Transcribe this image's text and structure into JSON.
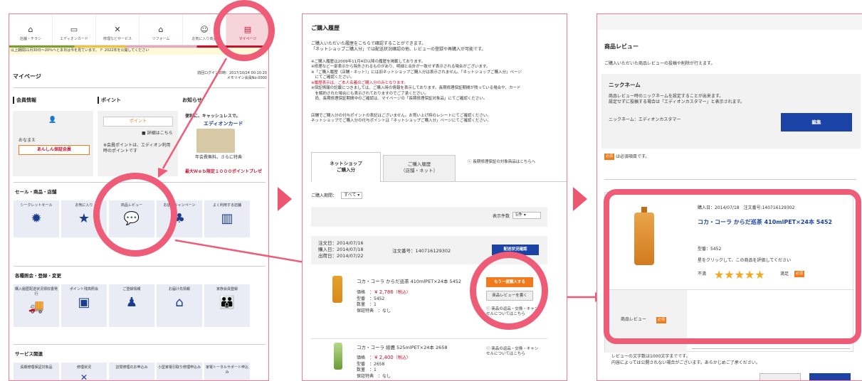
{
  "panel1": {
    "nav": [
      {
        "label": "店舗・チラシ",
        "icon": "shop-icon"
      },
      {
        "label": "エディオンカード",
        "icon": "card-icon"
      },
      {
        "label": "修理などサービス",
        "icon": "tools-icon"
      },
      {
        "label": "リフォーム",
        "icon": "house-icon"
      },
      {
        "label": "お気に入り商品",
        "icon": "heart-icon"
      },
      {
        "label": "マイページ",
        "icon": "mypage-icon"
      }
    ],
    "notice": "以上期間11月30日～20％ヘと本日は今を見ています。 Ｆ 2022年を公開してください",
    "title": "マイページ",
    "login_info": "前回ログイン日時：2017/10/24 00:10:20",
    "member_no": "メモリイン会員No:0000",
    "col1": "会員情報",
    "col2": "ポイント",
    "col3": "お知らせ",
    "member_name": "おなまえ",
    "member_rank": "あんしん保証会員",
    "point_label": "ポイント",
    "point_detail": "■ 詳細はこちら",
    "point_text": "※会員ポイントは、エディオン利用時のポイントです",
    "news_title": "便利に、キャッシュレスで。",
    "card_title": "エディオンカード",
    "card_text": "年会費無料。さらに特典",
    "campaign": "最大Ｗｅｂ限定１０００ポイントプレゼ",
    "sec1": "セール・商品・店舗",
    "sec1_tiles": [
      "シークレットセール",
      "お気に入り",
      "商品レビュー",
      "お店のキャンペーン",
      "よく利用する店舗"
    ],
    "sec2": "各種照会・登録・変更",
    "sec2_tiles": [
      "購入履歴配送状況領収書発行",
      "ポイント残高照会",
      "ご登録情報",
      "お届け先情報",
      "家族会員登録"
    ],
    "sec3": "サービス関連",
    "sec3_tiles": [
      "長期修理保証対象品",
      "修理状況",
      "訪問修理のお申込み",
      "小型家電引取り修理申込み",
      "家電トータルサポート申込み"
    ]
  },
  "panel2": {
    "title": "ご購入履歴",
    "intro1": "ご購入いただいた履歴をこちらで確認することができます。",
    "intro2": "「ネットショップご購入分」では配送状況確認の他、レビューの登録や再購入が可能です。",
    "notes": [
      "※ご購入履歴は2009年11月4日以降の履歴を掲載しております。",
      "※修理など一部表示から除外されるものがあり、明細と合計が一致せず表示される場合がございます。",
      "※「ご購入履歴（店舗・ネット）」には旧ネットショップご購入分は表示されません。「ネットショップご購入分」ページ",
      "　にてご確認ください。",
      "※履歴表示は、ご本人名義のご購入分のみとなります。",
      "※保証情報の記載につきましては、ご購入時の情報を表示しております。長期修理保証期間が残っている場合や、カード",
      "　を解約された場合にも表示されておりますのでご了承ください。",
      "　尚、長期修理保証期間中のご確認は、マイページの「長期修理保証対象品」にてご確認ください。"
    ],
    "notes2": [
      "店舗でご購入分の付与ポイントの表記はございません。お買い上げ時のレシートにてご確認ください。",
      "ネットショップでご購入分の付与ポイントは「ネットショップご購入分」ページにてご確認ください。"
    ],
    "tab_active": [
      "ネットショップ",
      "ご購入分"
    ],
    "tab_inactive": [
      "ご購入履歴",
      "（店舗・ネット）"
    ],
    "long_warranty": "ⓘ 長期修理保証の対象商品はこちらへ",
    "period_label": "ご購入期間：",
    "period_value": "すべて",
    "per_page_label": "表示件数",
    "per_page_value": "5件",
    "order": {
      "ordered": "注文日：2014/07/16",
      "bought": "購入日：2014/07/18",
      "shipped": "出荷日：2014/07/22",
      "order_no": "注文番号：140716129302",
      "track_btn": "配送状況確認"
    },
    "items": [
      {
        "name": "コカ・コーラ からだ巡茶 410mlPET×24本 5452",
        "price_label": "価格",
        "price": "：¥ 2,786",
        "tax": "（税込）",
        "code_label": "型番",
        "code": "：5452",
        "qty_label": "数量",
        "qty": "：1",
        "warranty_label": "保証特典",
        "warranty": "：なし"
      },
      {
        "name": "コカ・コーラ 綾鷹 525mlPET×24本 2658",
        "price_label": "価格",
        "price": "：¥ 2,400",
        "tax": "（税込）",
        "code_label": "型番",
        "code": "：2658",
        "qty_label": "数量",
        "qty": "：1",
        "warranty_label": "保証特典",
        "warranty": "：なし"
      }
    ],
    "rebuy_btn": "もう一度購入する",
    "review_btn": "商品レビューを書く",
    "return_text": "ⓘ 商品の返品・交換・キャンセルについてはこちら",
    "return_text2": "ⓘ 商品の返品・交換・キャンセルについてはこちら"
  },
  "panel3": {
    "title": "商品レビュー",
    "intro": "ご購入いただいた商品レビューの投稿や削除が行えます。",
    "nickname_title": "ニックネーム",
    "nickname_text1": "商品レビュー時のニックネームを設定することが出来ます。",
    "nickname_text2": "設定せずに投稿する場合は「エディオンカスタマー」と表示されます。",
    "nickname_label": "ニックネーム：エディオンカスタマー",
    "edit_btn": "編集",
    "required_badge": "必須",
    "required_note": "は必須項目です。",
    "purchase": "購入日：2014/07/18　注文番号:140716129302",
    "product": "コカ・コーラ からだ巡茶 410mlPET×24本 5452",
    "code": "型番：5452",
    "star_prompt": "星をクリックして、この商品を評価してください",
    "bad": "不満",
    "good": "満足",
    "stars": 5,
    "review_label": "商品レビュー",
    "bottom1": "レビューの文字数は1000文字までです。",
    "bottom2": "内容によっては公開されない場合がございます。あらかじめご了承ください。"
  }
}
